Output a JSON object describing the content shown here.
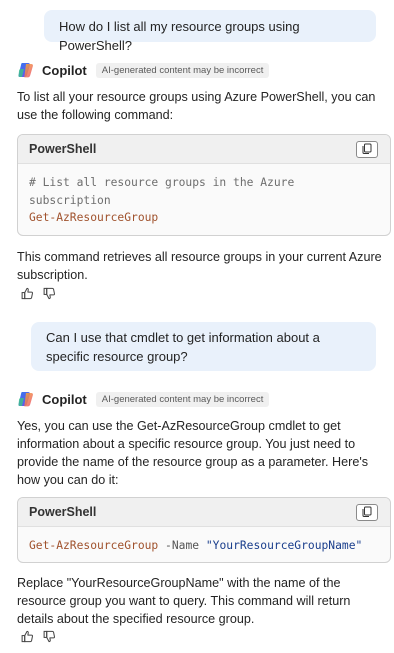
{
  "messages": {
    "user1": "How do I list all my resource groups using PowerShell?",
    "user2": "Can I use that cmdlet to get information about a specific resource group?"
  },
  "assistant": {
    "name": "Copilot",
    "disclaimer": "AI-generated content may be incorrect"
  },
  "response1": {
    "intro": "To list all your resource groups using Azure PowerShell, you can use the following command:",
    "code_language": "PowerShell",
    "code_comment_line1": "# List all resource groups in the Azure",
    "code_comment_line2": "subscription",
    "code_command": "Get-AzResourceGroup",
    "outro": "This command retrieves all resource groups in your current Azure subscription."
  },
  "response2": {
    "intro": "Yes, you can use the Get-AzResourceGroup cmdlet to get information about a specific resource group. You just need to provide the name of the resource group as a parameter. Here's how you can do it:",
    "code_language": "PowerShell",
    "code_command": "Get-AzResourceGroup",
    "code_param": "-Name",
    "code_value": "\"YourResourceGroupName\"",
    "outro": "Replace \"YourResourceGroupName\" with the name of the resource group you want to query. This command will return details about the specified resource group."
  },
  "icons": {
    "copy": "copy-icon",
    "thumbs_up": "thumbs-up-icon",
    "thumbs_down": "thumbs-down-icon",
    "logo": "copilot-logo-icon"
  },
  "colors": {
    "user_bubble": "#e9f1fb",
    "code_command": "#a0522d",
    "code_string": "#1a3e8c",
    "code_comment": "#6e6e6e"
  }
}
